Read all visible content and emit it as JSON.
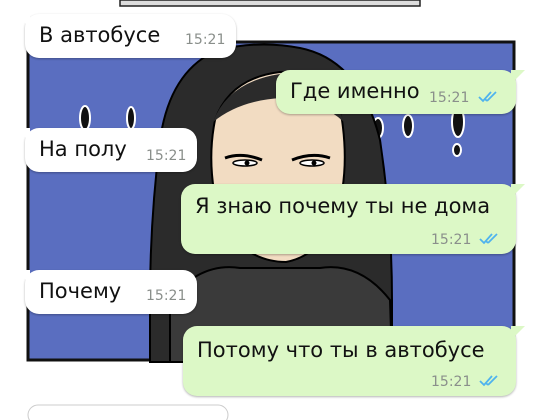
{
  "chat": {
    "messages": [
      {
        "direction": "in",
        "text": "В автобусе",
        "time": "15:21"
      },
      {
        "direction": "out",
        "text": "Где именно",
        "time": "15:21",
        "status": "read-double-check-icon"
      },
      {
        "direction": "in",
        "text": "На полу",
        "time": "15:21"
      },
      {
        "direction": "out",
        "text": "Я знаю почему ты не дома",
        "time": "15:21",
        "status": "read-double-check-icon"
      },
      {
        "direction": "in",
        "text": "Почему",
        "time": "15:21"
      },
      {
        "direction": "out",
        "text": "Потому что ты  в автобусе",
        "time": "15:21",
        "status": "read-double-check-icon"
      }
    ]
  },
  "colors": {
    "incoming_bubble": "#ffffff",
    "outgoing_bubble": "#dcf8c6",
    "read_ticks": "#4fb3ee",
    "comic_background": "#5a6ec0"
  }
}
